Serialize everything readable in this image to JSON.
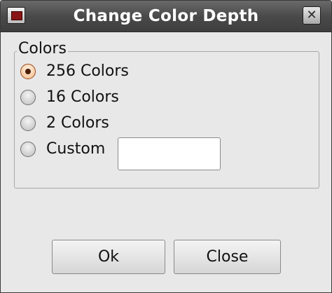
{
  "window": {
    "title": "Change Color Depth",
    "close_glyph": "✕"
  },
  "group": {
    "label": "Colors",
    "options": [
      {
        "label": "256 Colors",
        "checked": true
      },
      {
        "label": "16 Colors",
        "checked": false
      },
      {
        "label": "2 Colors",
        "checked": false
      },
      {
        "label": "Custom",
        "checked": false
      }
    ],
    "custom_value": ""
  },
  "buttons": {
    "ok_label": "Ok",
    "close_label": "Close"
  },
  "icons": {
    "app": "app-window-icon",
    "close": "close-icon",
    "radio_checked": "radio-checked-icon",
    "radio_unchecked": "radio-unchecked-icon"
  },
  "colors": {
    "titlebar": "#4a4a4a",
    "dialog_bg": "#e8e8e8",
    "radio_selected": "#f2b884",
    "app_icon_inner": "#8a1414"
  }
}
